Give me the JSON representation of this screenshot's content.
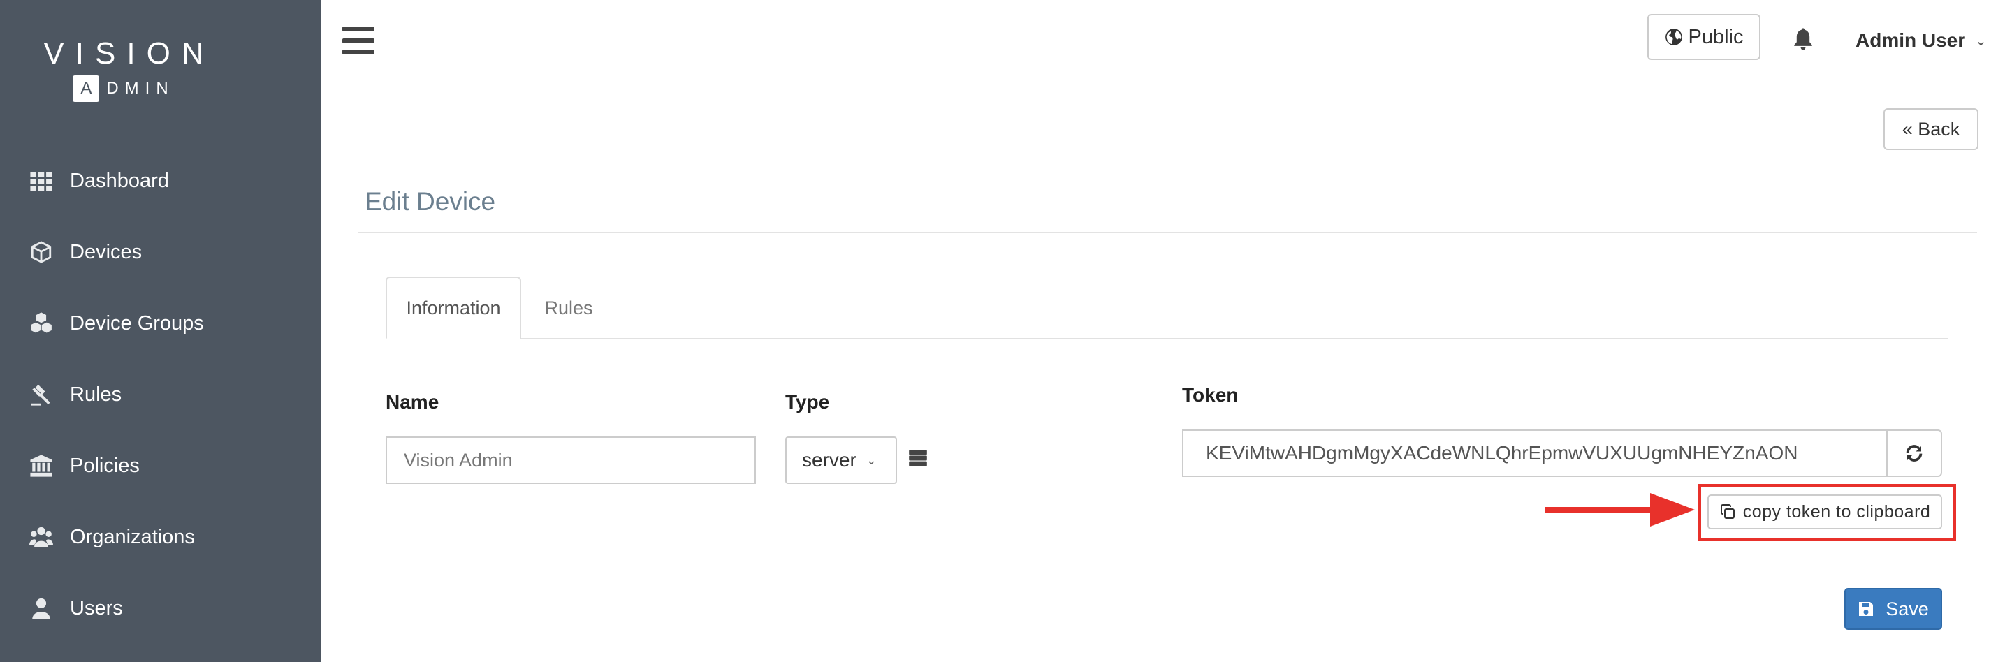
{
  "brand": {
    "line1": "VISION",
    "line2_box": "A",
    "line2_rest": "DMIN"
  },
  "sidebar": {
    "items": [
      {
        "label": "Dashboard",
        "icon": "grid-icon"
      },
      {
        "label": "Devices",
        "icon": "cube-icon"
      },
      {
        "label": "Device Groups",
        "icon": "cubes-icon"
      },
      {
        "label": "Rules",
        "icon": "gavel-icon"
      },
      {
        "label": "Policies",
        "icon": "bank-icon"
      },
      {
        "label": "Organizations",
        "icon": "users-group-icon"
      },
      {
        "label": "Users",
        "icon": "user-icon"
      }
    ]
  },
  "header": {
    "public_label": "Public",
    "user_name": "Admin User"
  },
  "back_label": "« Back",
  "page_title": "Edit Device",
  "tabs": [
    {
      "label": "Information",
      "active": true
    },
    {
      "label": "Rules",
      "active": false
    }
  ],
  "form": {
    "name_label": "Name",
    "name_value": "Vision Admin",
    "type_label": "Type",
    "type_value": "server",
    "token_label": "Token",
    "token_value": "KEViMtwAHDgmMgyXACdeWNLQhrEpmwVUXUUgmNHEYZnAON",
    "copy_label": "copy token to clipboard",
    "save_label": "Save"
  },
  "colors": {
    "sidebar": "#4d5661",
    "accent": "#3a7bbf",
    "highlight": "#e8312b"
  }
}
